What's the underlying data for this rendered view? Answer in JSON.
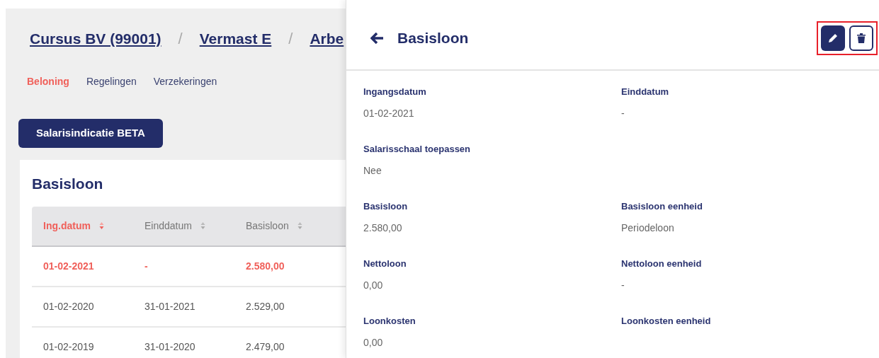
{
  "breadcrumb": [
    {
      "label": "Cursus BV (99001)"
    },
    {
      "separator": "/",
      "label": "Vermast E"
    },
    {
      "separator": "/",
      "label": "Arbe"
    }
  ],
  "tabs": [
    {
      "label": "Beloning",
      "selected": true
    },
    {
      "label": "Regelingen",
      "selected": false
    },
    {
      "label": "Verzekeringen",
      "selected": false
    }
  ],
  "action_button": "Salarisindicatie BETA",
  "card": {
    "title": "Basisloon",
    "table": {
      "columns": [
        {
          "label": "Ing.datum",
          "sorted": true
        },
        {
          "label": "Einddatum",
          "sorted": false
        },
        {
          "label": "Basisloon",
          "sorted": false
        }
      ],
      "rows": [
        {
          "selected": true,
          "cells": [
            "01-02-2021",
            "-",
            "2.580,00"
          ]
        },
        {
          "selected": false,
          "cells": [
            "01-02-2020",
            "31-01-2021",
            "2.529,00"
          ]
        },
        {
          "selected": false,
          "cells": [
            "01-02-2019",
            "31-01-2020",
            "2.479,00"
          ]
        }
      ]
    }
  },
  "detail_panel": {
    "title": "Basisloon",
    "actions_highlighted": true,
    "fields": [
      [
        {
          "label": "Ingangsdatum",
          "value": "01-02-2021"
        },
        {
          "label": "Einddatum",
          "value": "-"
        }
      ],
      [
        {
          "label": "Salarisschaal toepassen",
          "value": "Nee"
        }
      ],
      [
        {
          "label": "Basisloon",
          "value": "2.580,00"
        },
        {
          "label": "Basisloon eenheid",
          "value": "Periodeloon"
        }
      ],
      [
        {
          "label": "Nettoloon",
          "value": "0,00"
        },
        {
          "label": "Nettoloon eenheid",
          "value": "-"
        }
      ],
      [
        {
          "label": "Loonkosten",
          "value": "0,00"
        },
        {
          "label": "Loonkosten eenheid"
        }
      ]
    ]
  }
}
